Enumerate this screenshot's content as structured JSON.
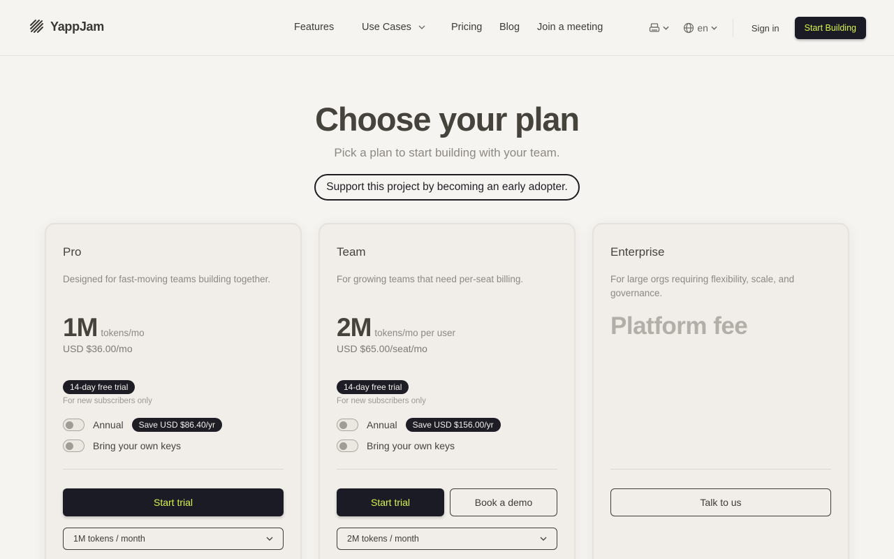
{
  "header": {
    "brand": "YappJam",
    "nav": {
      "features": "Features",
      "use_cases": "Use Cases",
      "pricing": "Pricing",
      "blog": "Blog",
      "join": "Join a meeting"
    },
    "language": "en",
    "sign_in": "Sign in",
    "start_building": "Start Building"
  },
  "hero": {
    "title": "Choose your plan",
    "subtitle": "Pick a plan to start building with your team.",
    "pill": "Support this project by becoming an early adopter."
  },
  "plans": {
    "pro": {
      "name": "Pro",
      "description": "Designed for fast-moving teams building together.",
      "amount": "1M",
      "unit": "tokens/mo",
      "usd": "USD $36.00/mo",
      "trial_badge": "14-day free trial",
      "trial_note": "For new subscribers only",
      "annual_label": "Annual",
      "save_badge": "Save USD $86.40/yr",
      "byok_label": "Bring your own keys",
      "cta": "Start trial",
      "select_value": "1M tokens / month"
    },
    "team": {
      "name": "Team",
      "description": "For growing teams that need per-seat billing.",
      "amount": "2M",
      "unit": "tokens/mo per user",
      "usd": "USD $65.00/seat/mo",
      "trial_badge": "14-day free trial",
      "trial_note": "For new subscribers only",
      "annual_label": "Annual",
      "save_badge": "Save USD $156.00/yr",
      "byok_label": "Bring your own keys",
      "cta": "Start trial",
      "secondary_cta": "Book a demo",
      "select_value": "2M tokens / month"
    },
    "enterprise": {
      "name": "Enterprise",
      "description": "For large orgs requiring flexibility, scale, and governance.",
      "price_label": "Platform fee",
      "cta": "Talk to us"
    }
  },
  "colors": {
    "background": "#f6f4f1",
    "dark": "#1b1b26",
    "accent": "#d8f24a",
    "card": "#f1eee9"
  },
  "icons": {
    "logo": "brand-logo-icon",
    "printer": "printer-icon",
    "globe": "globe-icon",
    "chevron": "chevron-down-icon"
  }
}
